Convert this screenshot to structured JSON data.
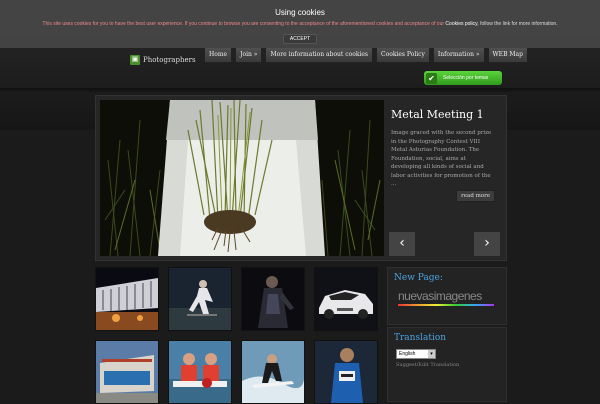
{
  "cookie": {
    "title": "Using cookies",
    "text": "This site uses cookies for you to have the best user experience. If you continue to browse you are consenting to the acceptance of the aforementioned cookies and acceptance of our",
    "policy_link": "Cookies policy",
    "text_tail": ", follow the link for more information.",
    "accept_label": "ACCEPT"
  },
  "logo": {
    "text": "Photographers"
  },
  "nav": {
    "items": [
      "Home",
      "Join »",
      "More information about cookies",
      "Cookies Policy",
      "Information »",
      "WEB Map"
    ]
  },
  "theme_button": {
    "label": "Selección por temas"
  },
  "slider": {
    "title": "Metal Meeting 1",
    "text": "Image graced with the second prize in the Photography Contest VIII Metal Asturias Foundation. The Foundation, social, aims at developing all kinds of social and labor activities for promotion of the ...",
    "read_more": "read more",
    "prev": "‹",
    "next": "›"
  },
  "sidebar": {
    "new_page_title": "New Page:",
    "banner_text": "nuevasimagenes",
    "translation_title": "Translation",
    "language_selected": "English",
    "edit_translation": "Suggest/Edit Translation"
  },
  "icons": {
    "logo": "camera-icon",
    "theme": "check-icon",
    "dropdown": "chevron-down-icon"
  },
  "colors": {
    "accent_blue": "#4aa3e0",
    "theme_green": "#3fb224",
    "cookie_text": "#e88888"
  }
}
